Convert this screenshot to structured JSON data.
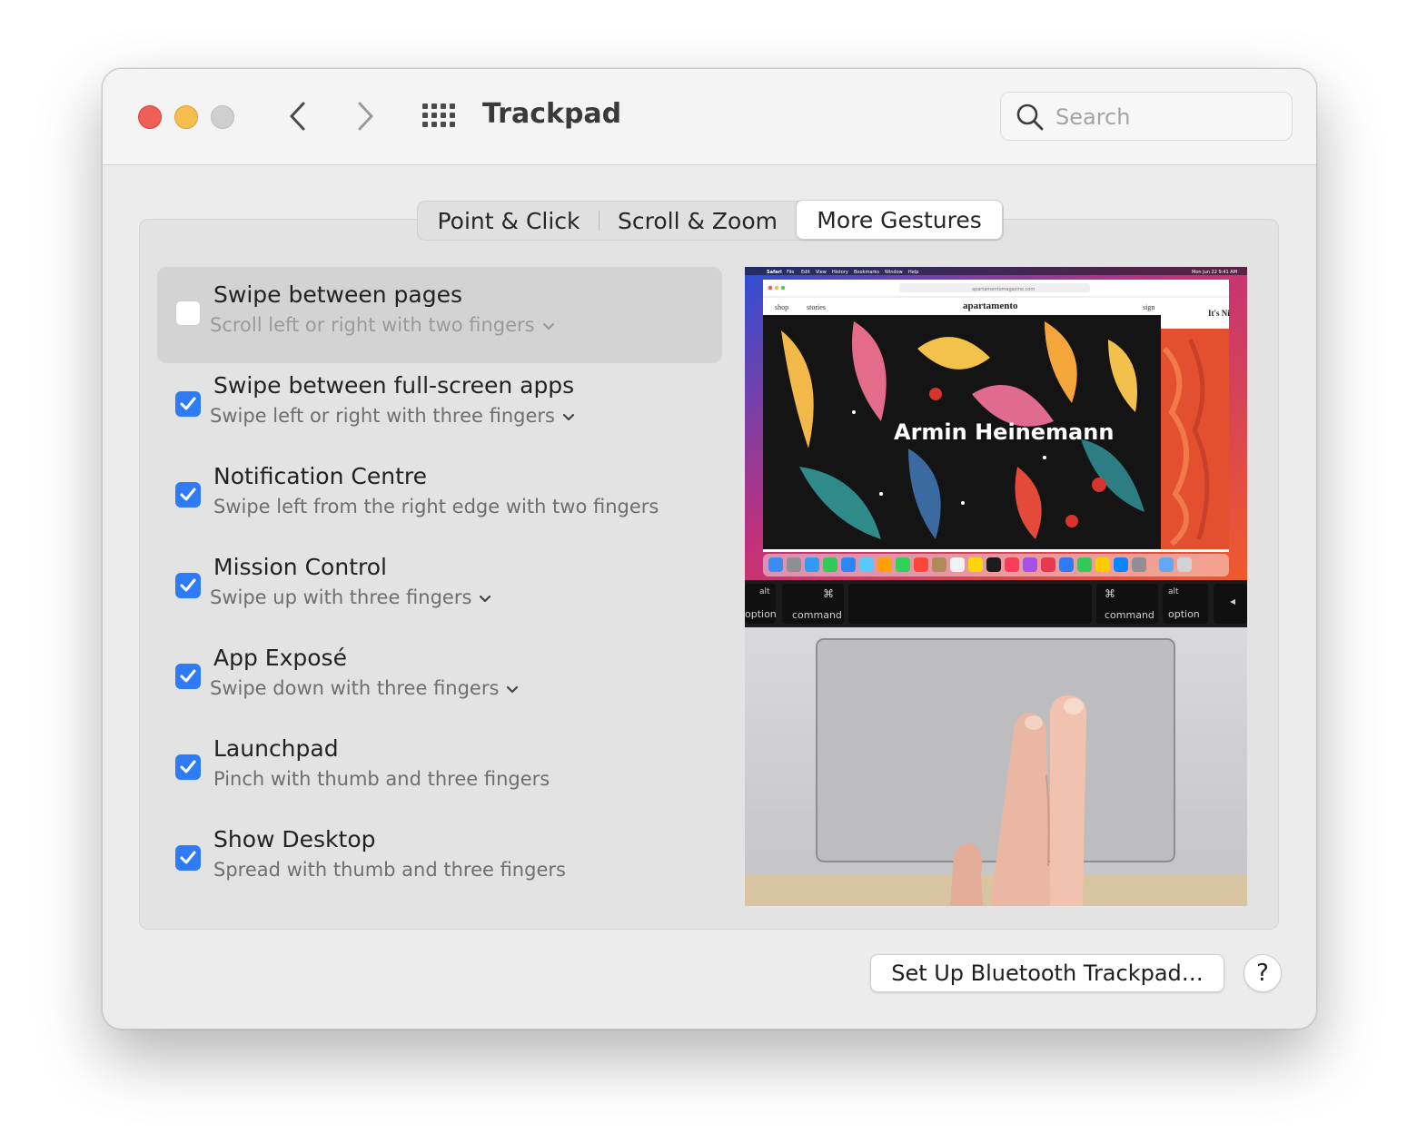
{
  "window": {
    "title": "Trackpad",
    "search_placeholder": "Search"
  },
  "tabs": [
    {
      "label": "Point & Click",
      "selected": false
    },
    {
      "label": "Scroll & Zoom",
      "selected": false
    },
    {
      "label": "More Gestures",
      "selected": true
    }
  ],
  "options": [
    {
      "label": "Swipe between pages",
      "sub": "Scroll left or right with two fingers",
      "checked": false,
      "has_menu": true
    },
    {
      "label": "Swipe between full-screen apps",
      "sub": "Swipe left or right with three fingers",
      "checked": true,
      "has_menu": true
    },
    {
      "label": "Notification Centre",
      "sub": "Swipe left from the right edge with two fingers",
      "checked": true,
      "has_menu": false
    },
    {
      "label": "Mission Control",
      "sub": "Swipe up with three fingers",
      "checked": true,
      "has_menu": true
    },
    {
      "label": "App Exposé",
      "sub": "Swipe down with three fingers",
      "checked": true,
      "has_menu": true
    },
    {
      "label": "Launchpad",
      "sub": "Pinch with thumb and three fingers",
      "checked": true,
      "has_menu": false
    },
    {
      "label": "Show Desktop",
      "sub": "Spread with thumb and three fingers",
      "checked": true,
      "has_menu": false
    }
  ],
  "preview": {
    "menu_app": "Safari",
    "menu_items": [
      "File",
      "Edit",
      "View",
      "History",
      "Bookmarks",
      "Window",
      "Help"
    ],
    "clock": "Mon Jun 22  9:41 AM",
    "url": "apartamentomagazine.com",
    "nav_left": [
      "shop",
      "stories"
    ],
    "site_name": "apartamento",
    "nav_right": "sign",
    "side_text": "It's Ni",
    "hero_text": "Armin Heinemann",
    "keys": {
      "left_option_top": "alt",
      "left_option": "option",
      "cmd_symbol": "⌘",
      "left_command": "command",
      "right_command": "command",
      "right_option_top": "alt",
      "right_option": "option"
    }
  },
  "buttons": {
    "bluetooth": "Set Up Bluetooth Trackpad…",
    "help": "?"
  },
  "colors": {
    "accent": "#2f7bf5",
    "close": "#ed5f57",
    "minimize": "#f6be4f",
    "zoom_disabled": "#cfcfcf"
  }
}
